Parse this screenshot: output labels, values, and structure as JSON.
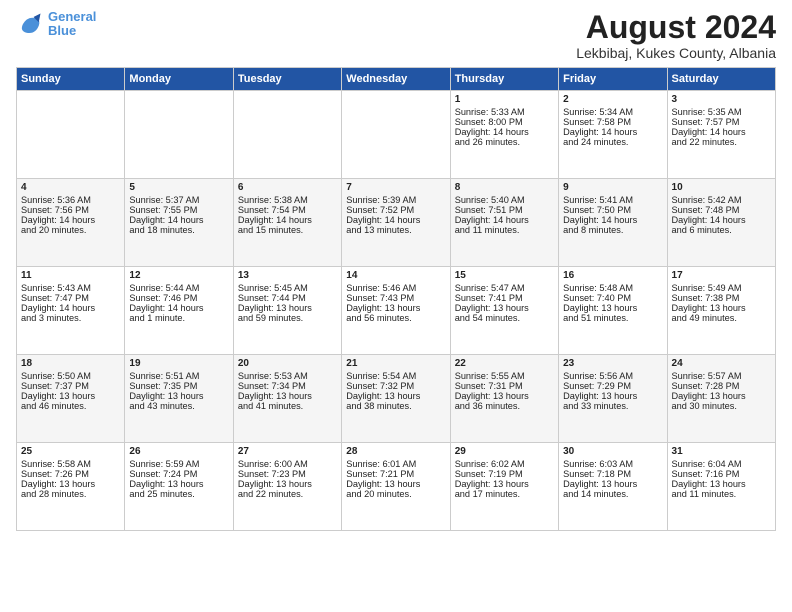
{
  "header": {
    "logo_line1": "General",
    "logo_line2": "Blue",
    "month": "August 2024",
    "location": "Lekbibaj, Kukes County, Albania"
  },
  "days_of_week": [
    "Sunday",
    "Monday",
    "Tuesday",
    "Wednesday",
    "Thursday",
    "Friday",
    "Saturday"
  ],
  "weeks": [
    [
      {
        "day": "",
        "text": ""
      },
      {
        "day": "",
        "text": ""
      },
      {
        "day": "",
        "text": ""
      },
      {
        "day": "",
        "text": ""
      },
      {
        "day": "1",
        "text": "Sunrise: 5:33 AM\nSunset: 8:00 PM\nDaylight: 14 hours\nand 26 minutes."
      },
      {
        "day": "2",
        "text": "Sunrise: 5:34 AM\nSunset: 7:58 PM\nDaylight: 14 hours\nand 24 minutes."
      },
      {
        "day": "3",
        "text": "Sunrise: 5:35 AM\nSunset: 7:57 PM\nDaylight: 14 hours\nand 22 minutes."
      }
    ],
    [
      {
        "day": "4",
        "text": "Sunrise: 5:36 AM\nSunset: 7:56 PM\nDaylight: 14 hours\nand 20 minutes."
      },
      {
        "day": "5",
        "text": "Sunrise: 5:37 AM\nSunset: 7:55 PM\nDaylight: 14 hours\nand 18 minutes."
      },
      {
        "day": "6",
        "text": "Sunrise: 5:38 AM\nSunset: 7:54 PM\nDaylight: 14 hours\nand 15 minutes."
      },
      {
        "day": "7",
        "text": "Sunrise: 5:39 AM\nSunset: 7:52 PM\nDaylight: 14 hours\nand 13 minutes."
      },
      {
        "day": "8",
        "text": "Sunrise: 5:40 AM\nSunset: 7:51 PM\nDaylight: 14 hours\nand 11 minutes."
      },
      {
        "day": "9",
        "text": "Sunrise: 5:41 AM\nSunset: 7:50 PM\nDaylight: 14 hours\nand 8 minutes."
      },
      {
        "day": "10",
        "text": "Sunrise: 5:42 AM\nSunset: 7:48 PM\nDaylight: 14 hours\nand 6 minutes."
      }
    ],
    [
      {
        "day": "11",
        "text": "Sunrise: 5:43 AM\nSunset: 7:47 PM\nDaylight: 14 hours\nand 3 minutes."
      },
      {
        "day": "12",
        "text": "Sunrise: 5:44 AM\nSunset: 7:46 PM\nDaylight: 14 hours\nand 1 minute."
      },
      {
        "day": "13",
        "text": "Sunrise: 5:45 AM\nSunset: 7:44 PM\nDaylight: 13 hours\nand 59 minutes."
      },
      {
        "day": "14",
        "text": "Sunrise: 5:46 AM\nSunset: 7:43 PM\nDaylight: 13 hours\nand 56 minutes."
      },
      {
        "day": "15",
        "text": "Sunrise: 5:47 AM\nSunset: 7:41 PM\nDaylight: 13 hours\nand 54 minutes."
      },
      {
        "day": "16",
        "text": "Sunrise: 5:48 AM\nSunset: 7:40 PM\nDaylight: 13 hours\nand 51 minutes."
      },
      {
        "day": "17",
        "text": "Sunrise: 5:49 AM\nSunset: 7:38 PM\nDaylight: 13 hours\nand 49 minutes."
      }
    ],
    [
      {
        "day": "18",
        "text": "Sunrise: 5:50 AM\nSunset: 7:37 PM\nDaylight: 13 hours\nand 46 minutes."
      },
      {
        "day": "19",
        "text": "Sunrise: 5:51 AM\nSunset: 7:35 PM\nDaylight: 13 hours\nand 43 minutes."
      },
      {
        "day": "20",
        "text": "Sunrise: 5:53 AM\nSunset: 7:34 PM\nDaylight: 13 hours\nand 41 minutes."
      },
      {
        "day": "21",
        "text": "Sunrise: 5:54 AM\nSunset: 7:32 PM\nDaylight: 13 hours\nand 38 minutes."
      },
      {
        "day": "22",
        "text": "Sunrise: 5:55 AM\nSunset: 7:31 PM\nDaylight: 13 hours\nand 36 minutes."
      },
      {
        "day": "23",
        "text": "Sunrise: 5:56 AM\nSunset: 7:29 PM\nDaylight: 13 hours\nand 33 minutes."
      },
      {
        "day": "24",
        "text": "Sunrise: 5:57 AM\nSunset: 7:28 PM\nDaylight: 13 hours\nand 30 minutes."
      }
    ],
    [
      {
        "day": "25",
        "text": "Sunrise: 5:58 AM\nSunset: 7:26 PM\nDaylight: 13 hours\nand 28 minutes."
      },
      {
        "day": "26",
        "text": "Sunrise: 5:59 AM\nSunset: 7:24 PM\nDaylight: 13 hours\nand 25 minutes."
      },
      {
        "day": "27",
        "text": "Sunrise: 6:00 AM\nSunset: 7:23 PM\nDaylight: 13 hours\nand 22 minutes."
      },
      {
        "day": "28",
        "text": "Sunrise: 6:01 AM\nSunset: 7:21 PM\nDaylight: 13 hours\nand 20 minutes."
      },
      {
        "day": "29",
        "text": "Sunrise: 6:02 AM\nSunset: 7:19 PM\nDaylight: 13 hours\nand 17 minutes."
      },
      {
        "day": "30",
        "text": "Sunrise: 6:03 AM\nSunset: 7:18 PM\nDaylight: 13 hours\nand 14 minutes."
      },
      {
        "day": "31",
        "text": "Sunrise: 6:04 AM\nSunset: 7:16 PM\nDaylight: 13 hours\nand 11 minutes."
      }
    ]
  ]
}
